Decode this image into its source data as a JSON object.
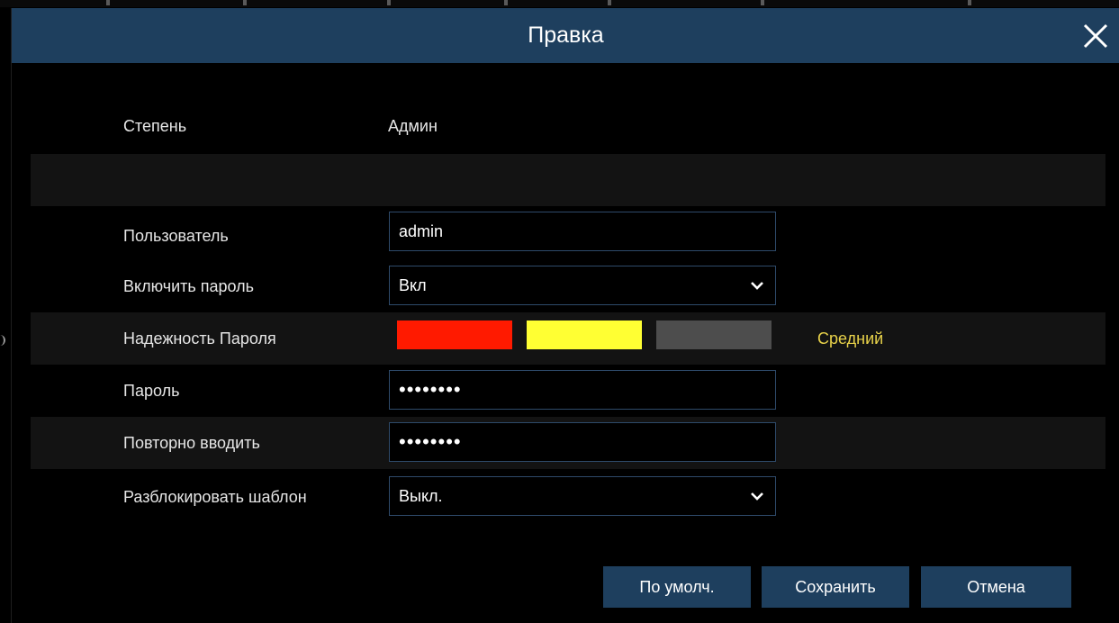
{
  "dialog": {
    "title": "Правка",
    "close_icon": "close-icon"
  },
  "form": {
    "level": {
      "label": "Степень",
      "value": "Админ"
    },
    "user": {
      "label": "Пользователь",
      "value": "admin"
    },
    "enable_password": {
      "label": "Включить пароль",
      "value": "Вкл"
    },
    "password_strength": {
      "label": "Надежность Пароля",
      "level_text": "Средний",
      "level_filled": 2,
      "level_total": 3,
      "colors": [
        "#ff1a00",
        "#ffff33",
        "#4d4d4d"
      ],
      "text_color": "#e8d24a"
    },
    "password": {
      "label": "Пароль",
      "value": "••••••••"
    },
    "repeat": {
      "label": "Повторно вводить",
      "value": "••••••••"
    },
    "unlock_pattern": {
      "label": "Разблокировать шаблон",
      "value": "Выкл."
    }
  },
  "buttons": {
    "default": "По умолч.",
    "save": "Сохранить",
    "cancel": "Отмена"
  },
  "colors": {
    "titlebar": "#1e3f5e",
    "button": "#1e3f5e",
    "field_border": "#2e4a6a"
  }
}
